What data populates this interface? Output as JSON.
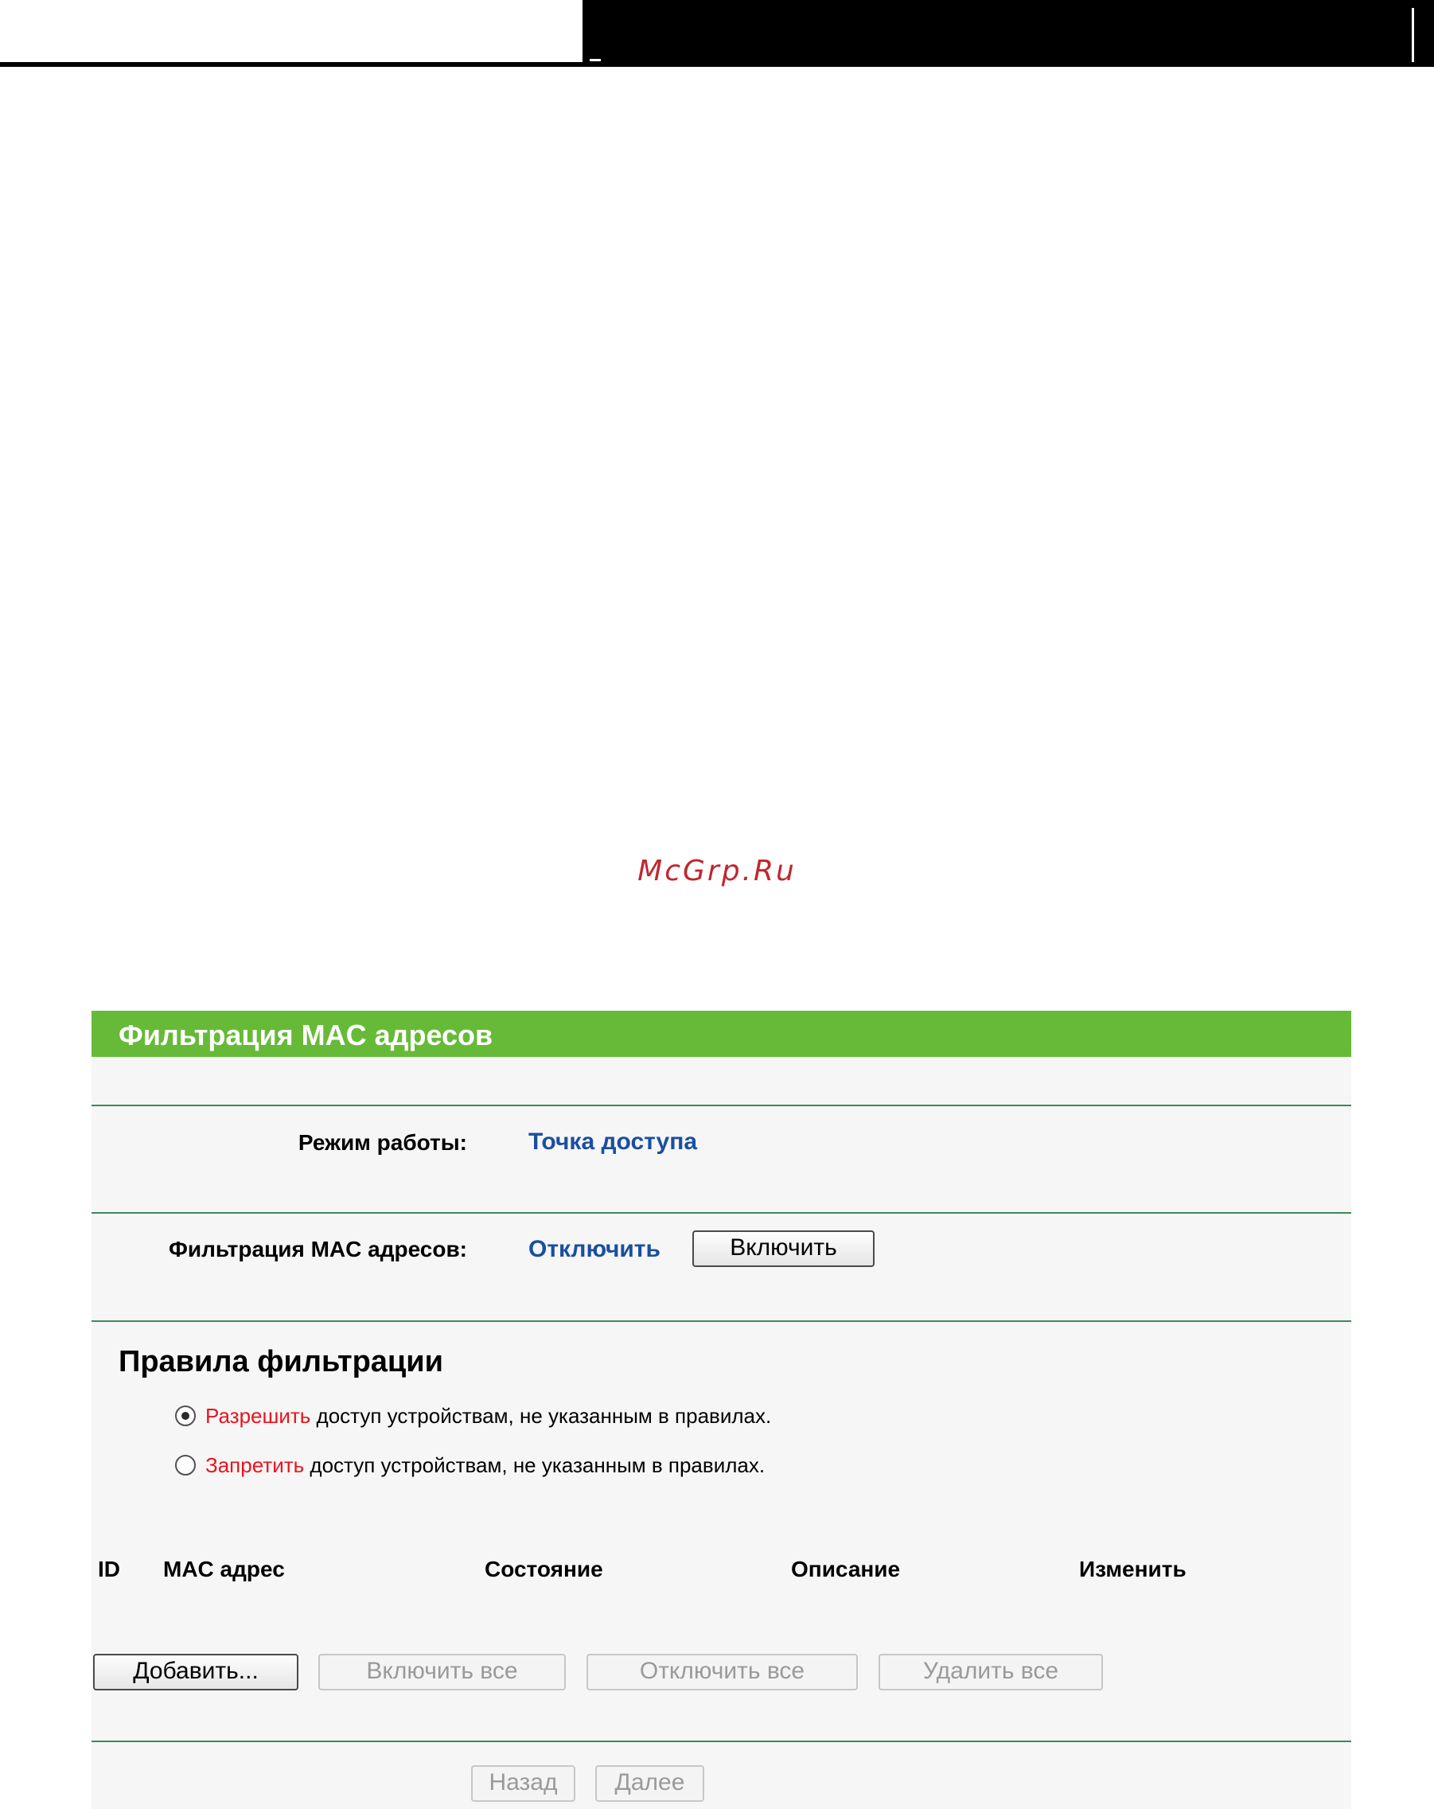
{
  "watermark": "McGrp.Ru",
  "panel": {
    "title": "Фильтрация MAC адресов",
    "mode_label": "Режим работы:",
    "mode_value": "Точка доступа",
    "filter_label": "Фильтрация MAC адресов:",
    "filter_state": "Отключить",
    "enable_button": "Включить"
  },
  "rules": {
    "title": "Правила фильтрации",
    "options": [
      {
        "keyword": "Разрешить",
        "text": " доступ устройствам, не указанным в правилах.",
        "checked": true
      },
      {
        "keyword": "Запретить",
        "text": " доступ устройствам, не указанным в правилах.",
        "checked": false
      }
    ]
  },
  "table": {
    "columns": [
      "ID",
      "MAC адрес",
      "Состояние",
      "Описание",
      "Изменить"
    ]
  },
  "actions": {
    "add": "Добавить...",
    "enable_all": "Включить все",
    "disable_all": "Отключить все",
    "delete_all": "Удалить все"
  },
  "nav": {
    "back": "Назад",
    "next": "Далее"
  },
  "colors": {
    "header_green": "#67ba38",
    "value_blue": "#1a4fa0",
    "keyword_red": "#e8141e"
  }
}
